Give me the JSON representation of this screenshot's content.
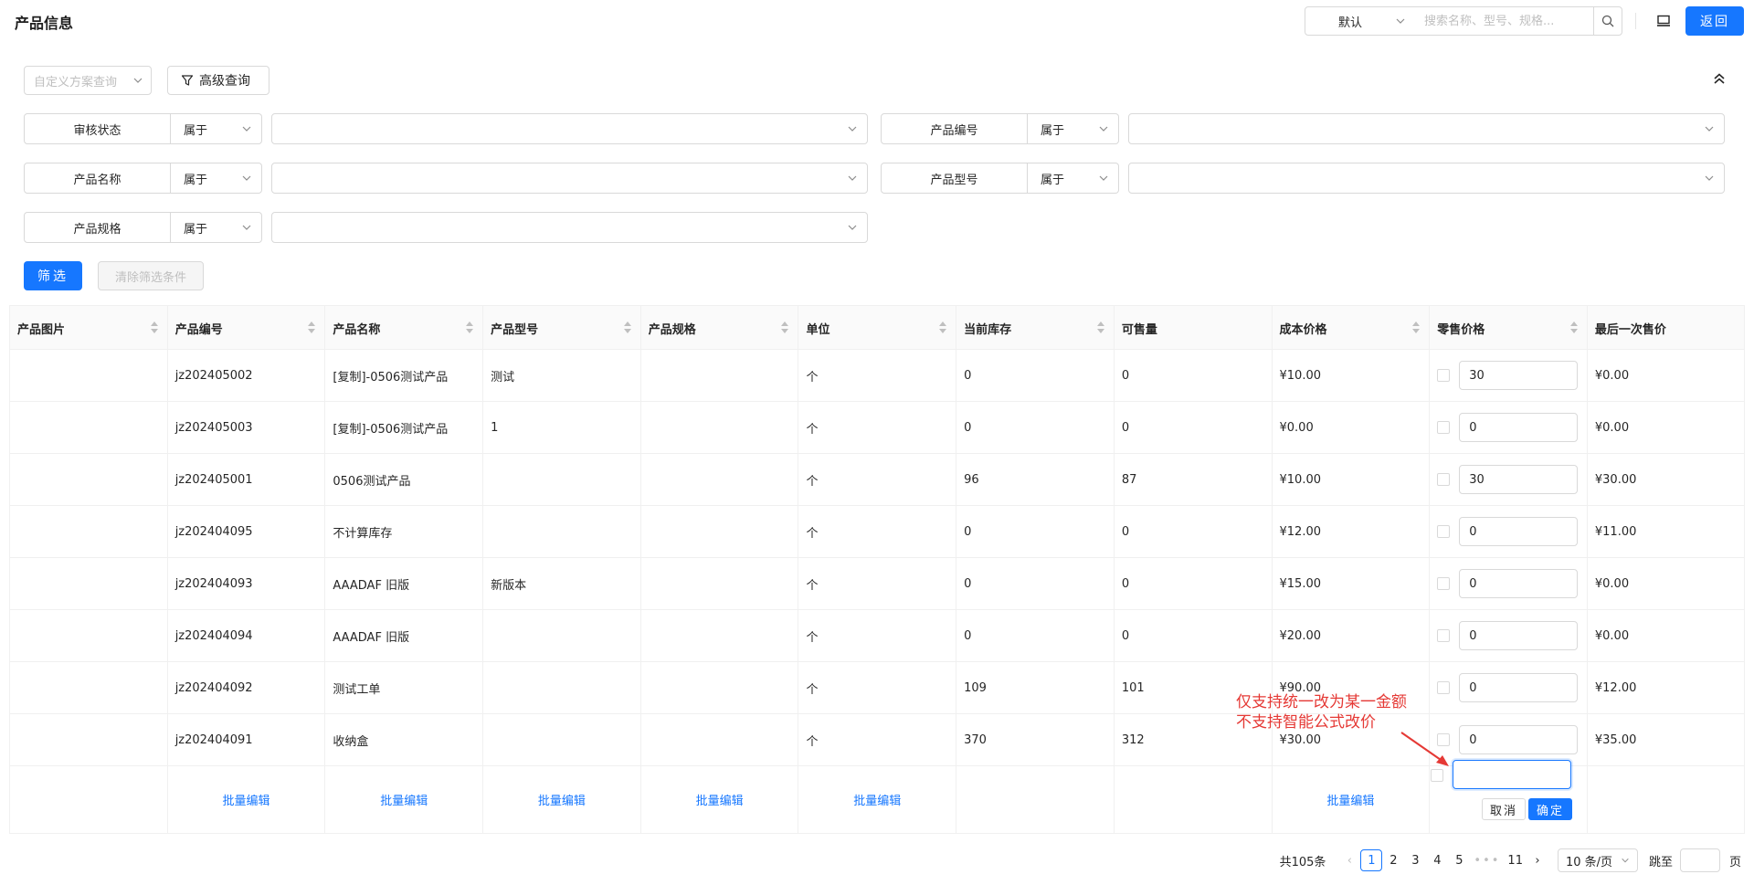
{
  "header": {
    "title": "产品信息",
    "view_select": "默认",
    "search_placeholder": "搜索名称、型号、规格...",
    "back_label": "返回"
  },
  "filters": {
    "scheme_placeholder": "自定义方案查询",
    "advanced_label": "高级查询",
    "rows": [
      {
        "label": "审核状态",
        "op": "属于"
      },
      {
        "label": "产品编号",
        "op": "属于"
      },
      {
        "label": "产品名称",
        "op": "属于"
      },
      {
        "label": "产品型号",
        "op": "属于"
      },
      {
        "label": "产品规格",
        "op": "属于"
      }
    ],
    "filter_label": "筛选",
    "clear_label": "清除筛选条件"
  },
  "table": {
    "columns": [
      "产品图片",
      "产品编号",
      "产品名称",
      "产品型号",
      "产品规格",
      "单位",
      "当前库存",
      "可售量",
      "成本价格",
      "零售价格",
      "最后一次售价"
    ],
    "rows": [
      {
        "code": "jz202405002",
        "name": "[复制]-0506测试产品",
        "model": "测试",
        "spec": "",
        "unit": "个",
        "stock": "0",
        "available": "0",
        "cost": "¥10.00",
        "retail": "30",
        "last": "¥0.00"
      },
      {
        "code": "jz202405003",
        "name": "[复制]-0506测试产品",
        "model": "1",
        "spec": "",
        "unit": "个",
        "stock": "0",
        "available": "0",
        "cost": "¥0.00",
        "retail": "0",
        "last": "¥0.00"
      },
      {
        "code": "jz202405001",
        "name": "0506测试产品",
        "model": "",
        "spec": "",
        "unit": "个",
        "stock": "96",
        "available": "87",
        "cost": "¥10.00",
        "retail": "30",
        "last": "¥30.00"
      },
      {
        "code": "jz202404095",
        "name": "不计算库存",
        "model": "",
        "spec": "",
        "unit": "个",
        "stock": "0",
        "available": "0",
        "cost": "¥12.00",
        "retail": "0",
        "last": "¥11.00"
      },
      {
        "code": "jz202404093",
        "name": "AAADAF 旧版",
        "model": "新版本",
        "spec": "",
        "unit": "个",
        "stock": "0",
        "available": "0",
        "cost": "¥15.00",
        "retail": "0",
        "last": "¥0.00"
      },
      {
        "code": "jz202404094",
        "name": "AAADAF 旧版",
        "model": "",
        "spec": "",
        "unit": "个",
        "stock": "0",
        "available": "0",
        "cost": "¥20.00",
        "retail": "0",
        "last": "¥0.00"
      },
      {
        "code": "jz202404092",
        "name": "测试工单",
        "model": "",
        "spec": "",
        "unit": "个",
        "stock": "109",
        "available": "101",
        "cost": "¥90.00",
        "retail": "0",
        "last": "¥12.00"
      },
      {
        "code": "jz202404091",
        "name": "收纳盒",
        "model": "",
        "spec": "",
        "unit": "个",
        "stock": "370",
        "available": "312",
        "cost": "¥30.00",
        "retail": "0",
        "last": "¥35.00"
      }
    ],
    "batch_label": "批量编辑"
  },
  "popover": {
    "input_value": "",
    "cancel_label": "取消",
    "ok_label": "确定"
  },
  "annotation": {
    "line1": "仅支持统一改为某一金额",
    "line2": "不支持智能公式改价",
    "color": "#e53935"
  },
  "pagination": {
    "total": "共105条",
    "pages": [
      "1",
      "2",
      "3",
      "4",
      "5"
    ],
    "dots": "•••",
    "last_page": "11",
    "page_size": "10 条/页",
    "jump_label": "跳至",
    "page_label": "页"
  },
  "colors": {
    "primary": "#1677ff",
    "border": "#d9d9d9"
  }
}
